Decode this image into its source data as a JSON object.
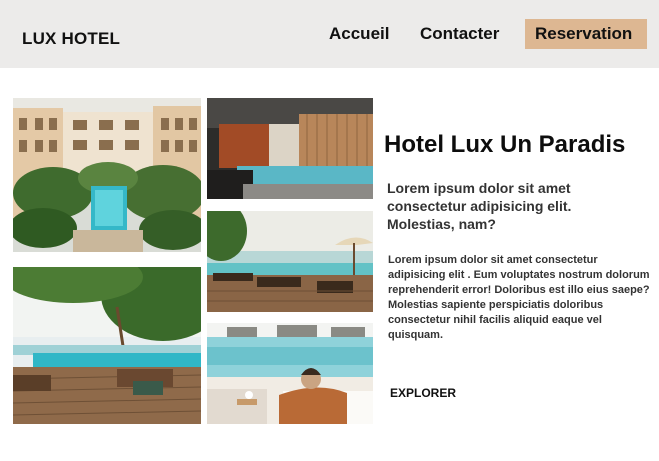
{
  "header": {
    "logo": "LUX HOTEL",
    "nav": {
      "home": "Accueil",
      "contact": "Contacter",
      "reservation": "Reservation"
    },
    "colors": {
      "bar": "#ecebea",
      "reservation_bg": "#ddb792"
    }
  },
  "hero": {
    "title": "Hotel Lux Un Paradis",
    "subtitle": "Lorem ipsum dolor sit amet consectetur adipisicing elit. Molestias, nam?",
    "body": "Lorem ipsum dolor sit amet consectetur adipisicing elit . Eum voluptates nostrum dolorum reprehenderit error! Doloribus est illo eius saepe? Molestias sapiente perspiciatis doloribus consectetur nihil facilis aliquid eaque vel quisquam.",
    "cta": "EXPLORER"
  }
}
